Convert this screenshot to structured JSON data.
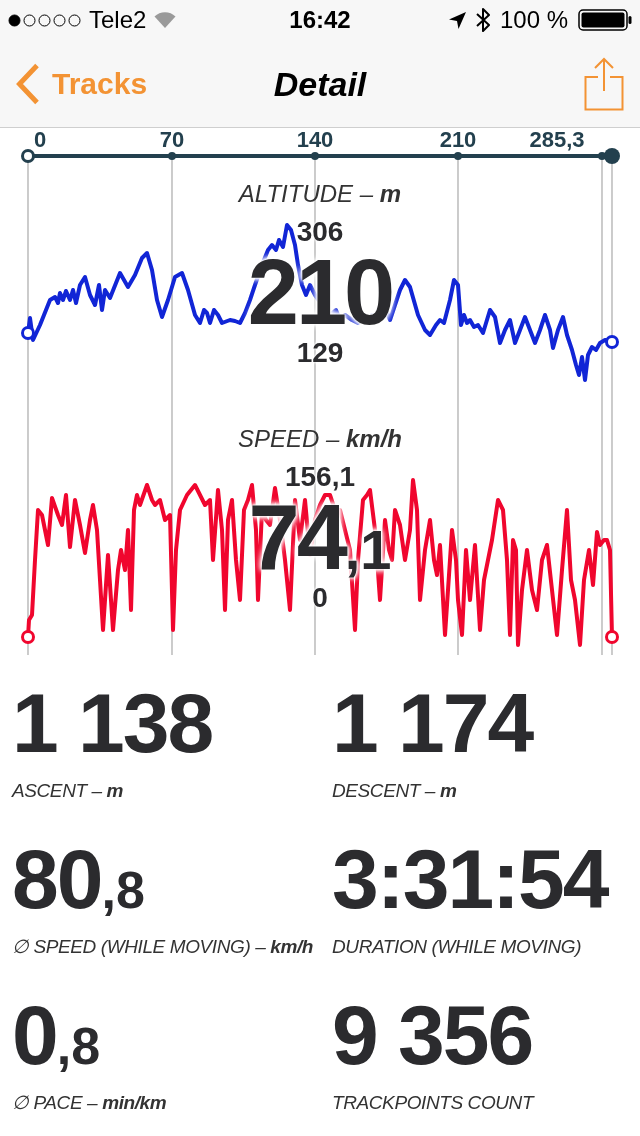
{
  "status_bar": {
    "carrier": "Tele2",
    "time": "16:42",
    "battery": "100 %"
  },
  "nav_bar": {
    "back": "Tracks",
    "title": "Detail"
  },
  "distance_axis": {
    "ticks": [
      "0",
      "70",
      "140",
      "210",
      "285,3"
    ]
  },
  "charts": [
    {
      "kind": "altitude",
      "title": "ALTITUDE – **m**",
      "max": "306",
      "current": "210",
      "min": "129"
    },
    {
      "kind": "speed",
      "title": "SPEED – **km/h**",
      "max": "156,1",
      "current": "74",
      "current_fraction": ",1",
      "min": "0"
    }
  ],
  "stats": [
    {
      "value": "1 138",
      "label": "ASCENT – **m**"
    },
    {
      "value": "1 174",
      "label": "DESCENT – **m**"
    },
    {
      "value": "80",
      "fraction": ",8",
      "label": "∅ SPEED (WHILE MOVING) – **km/h**"
    },
    {
      "value": "3:31:54",
      "label": "DURATION (WHILE MOVING)"
    },
    {
      "value": "0",
      "fraction": ",8",
      "label": "∅ PACE – **min/km**"
    },
    {
      "value": "9 356",
      "label": "TRACKPOINTS COUNT"
    }
  ]
}
